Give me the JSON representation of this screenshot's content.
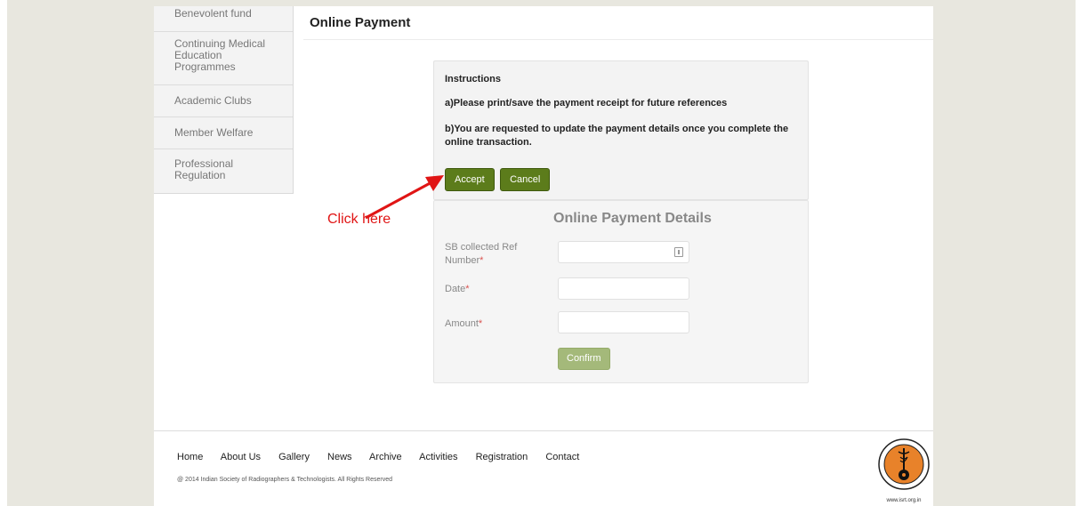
{
  "page": {
    "title": "Online Payment"
  },
  "sidebar": {
    "items": [
      {
        "label": "Benevolent fund"
      },
      {
        "label": "Continuing Medical Education Programmes"
      },
      {
        "label": "Academic Clubs"
      },
      {
        "label": "Member Welfare"
      },
      {
        "label": "Professional Regulation"
      }
    ]
  },
  "instructions": {
    "heading": "Instructions",
    "line_a": "a)Please print/save the payment receipt for future references",
    "line_b": "b)You are requested to update the payment details once you complete the online transaction.",
    "accept_label": "Accept",
    "cancel_label": "Cancel"
  },
  "annotation": {
    "text": "Click here",
    "color": "#e01515"
  },
  "details": {
    "title": "Online Payment Details",
    "ref_label": "SB collected Ref Number",
    "date_label": "Date",
    "amount_label": "Amount",
    "required_mark": "*",
    "confirm_label": "Confirm"
  },
  "footer": {
    "nav": [
      "Home",
      "About Us",
      "Gallery",
      "News",
      "Archive",
      "Activities",
      "Registration",
      "Contact"
    ],
    "copyright": "@ 2014 Indian Society of Radiographers & Technologists. All Rights Reserved",
    "logo_url": "www.isrt.org.in"
  },
  "colors": {
    "button_green": "#5c7c1b",
    "confirm_green": "#a4b97a",
    "background": "#e8e7df",
    "logo_orange": "#e8822a"
  }
}
